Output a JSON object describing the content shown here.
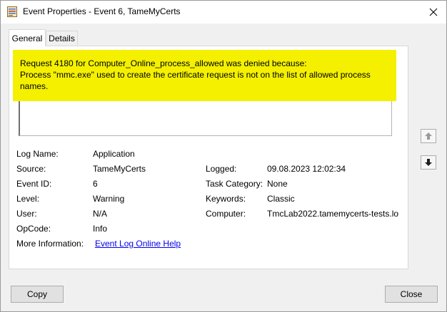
{
  "window": {
    "title": "Event Properties - Event 6, TameMyCerts"
  },
  "tabs": [
    {
      "label": "General",
      "active": true
    },
    {
      "label": "Details",
      "active": false
    }
  ],
  "message": {
    "lines": [
      "Request 4180 for Computer_Online_process_allowed was denied because:",
      "Process \"mmc.exe\" used to create the certificate request is not on the list of allowed process",
      "names."
    ],
    "highlight_color": "#f4f000"
  },
  "fields": {
    "log_name": {
      "label": "Log Name:",
      "value": "Application"
    },
    "source": {
      "label": "Source:",
      "value": "TameMyCerts"
    },
    "logged": {
      "label": "Logged:",
      "value": "09.08.2023 12:02:34"
    },
    "event_id": {
      "label": "Event ID:",
      "value": "6"
    },
    "task_category": {
      "label": "Task Category:",
      "value": "None"
    },
    "level": {
      "label": "Level:",
      "value": "Warning"
    },
    "keywords": {
      "label": "Keywords:",
      "value": "Classic"
    },
    "user": {
      "label": "User:",
      "value": "N/A"
    },
    "computer": {
      "label": "Computer:",
      "value": "TmcLab2022.tamemycerts-tests.lo"
    },
    "opcode": {
      "label": "OpCode:",
      "value": "Info"
    },
    "more_info": {
      "label": "More Information:",
      "link": "Event Log Online Help"
    }
  },
  "buttons": {
    "copy": "Copy",
    "close": "Close"
  },
  "icons": {
    "app": "event-viewer-icon",
    "close": "close-icon",
    "up": "arrow-up-icon",
    "down": "arrow-down-icon"
  }
}
